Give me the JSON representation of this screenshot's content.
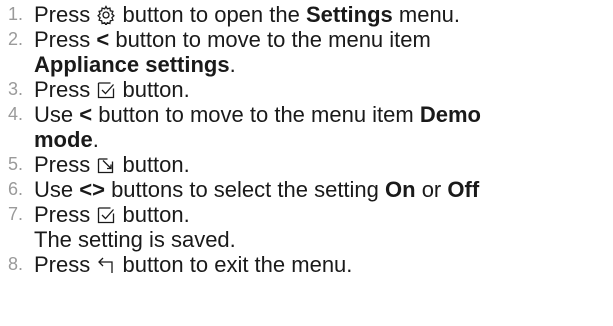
{
  "steps": [
    {
      "num": "1.",
      "a": "Press ",
      "icon": "gear-icon",
      "b": " button to open the ",
      "bold1": "Settings",
      "c": " menu."
    },
    {
      "num": "2.",
      "a": "Press ",
      "sym": "<",
      "b": " button to move to the menu item",
      "bold2": "Appliance settings",
      "c": "."
    },
    {
      "num": "3.",
      "a": "Press ",
      "icon": "checkbox-check-icon",
      "b": " button."
    },
    {
      "num": "4.",
      "a": "Use ",
      "sym": "<",
      "b": " button to move to the menu item ",
      "bold1": "Demo",
      "bold2": "mode",
      "c": "."
    },
    {
      "num": "5.",
      "a": "Press ",
      "icon": "edit-box-icon",
      "b": " button."
    },
    {
      "num": "6.",
      "a": "Use ",
      "sym": "<>",
      "b": " buttons to select the setting ",
      "bold1": "On",
      "c": " or ",
      "bold3": "Off"
    },
    {
      "num": "7.",
      "a": "Press ",
      "icon": "checkbox-check-icon",
      "b": " button.",
      "line2": "The setting is saved."
    },
    {
      "num": "8.",
      "a": "Press ",
      "icon": "back-icon",
      "b": " button to exit the menu."
    }
  ]
}
